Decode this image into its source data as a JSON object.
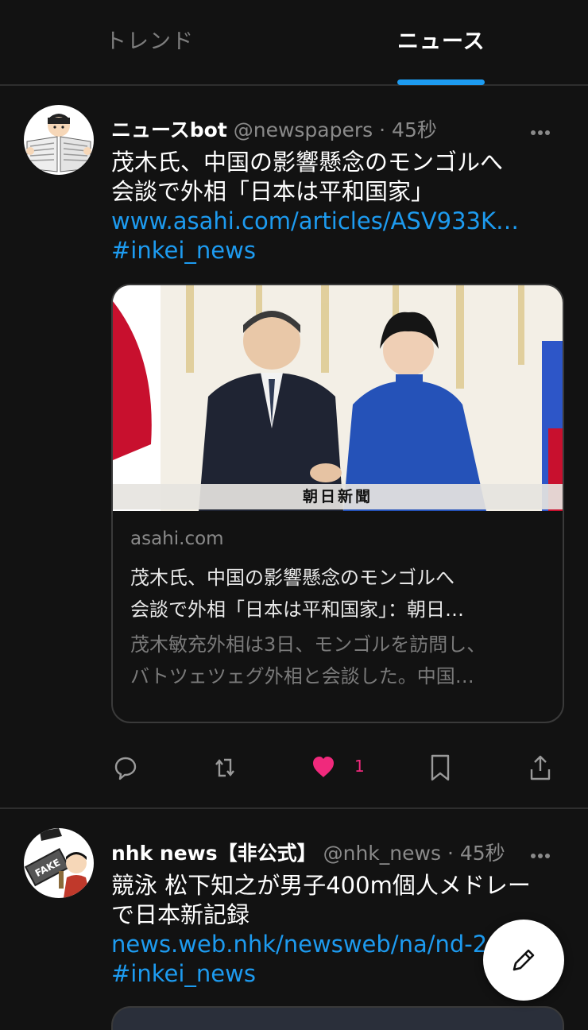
{
  "tabs": [
    {
      "label": "トレンド",
      "active": false
    },
    {
      "label": "ニュース",
      "active": true
    }
  ],
  "posts": [
    {
      "author": "ニュースbot",
      "handle": "@newspapers",
      "separator": "·",
      "time": "45秒",
      "avatar_icon": "newspaper-reader-icon",
      "text_lines": [
        "茂木氏、中国の影響懸念のモンゴルへ",
        "会談で外相「日本は平和国家」"
      ],
      "link": "www.asahi.com/articles/ASV933K…",
      "hashtag": "#inkei_news",
      "card": {
        "image_caption": "朝日新聞",
        "domain": "asahi.com",
        "title_lines": [
          "茂木氏、中国の影響懸念のモンゴルへ",
          "会談で外相「日本は平和国家」：朝日…"
        ],
        "desc_lines": [
          "茂木敏充外相は3日、モンゴルを訪問し、",
          "バトツェツェグ外相と会談した。中国…"
        ]
      },
      "actions": {
        "like_count": "1"
      }
    },
    {
      "author": "nhk news【非公式】",
      "handle": "@nhk_news",
      "separator": "·",
      "time": "45秒",
      "avatar_icon": "fake-sign-icon",
      "avatar_text": "FAKE",
      "text_lines": [
        "競泳 松下知之が男子400m個人メドレー",
        "で日本新記録"
      ],
      "link": "news.web.nhk/newsweb/na/nd-20",
      "hashtag": "#inkei_news"
    }
  ],
  "colors": {
    "background": "#121212",
    "accent": "#1d9bf0",
    "like": "#f0297c",
    "muted": "#8a8a8a"
  },
  "fab": {
    "icon": "pencil-icon"
  }
}
